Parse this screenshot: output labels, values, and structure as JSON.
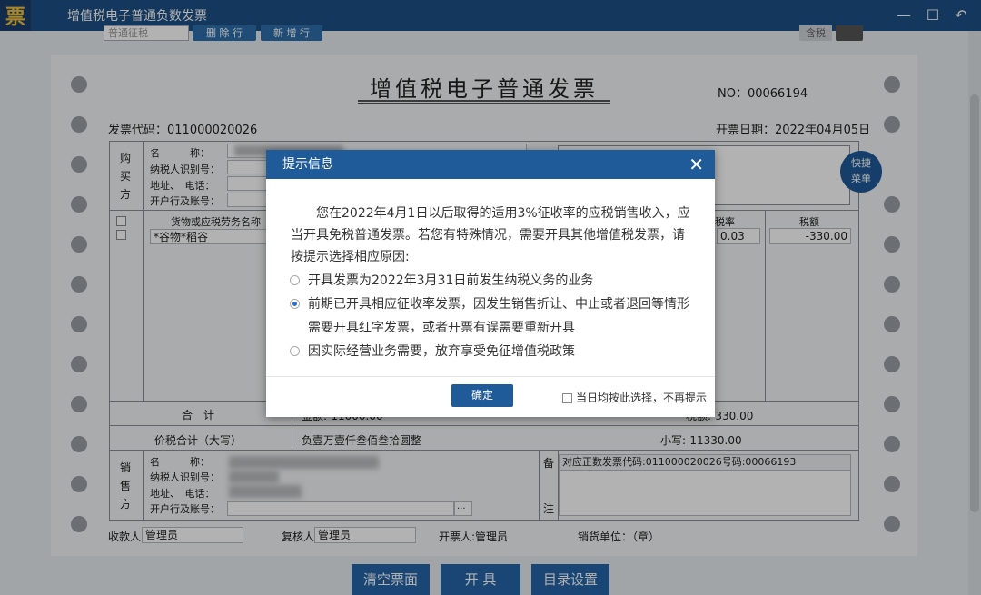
{
  "app": {
    "logo": "票",
    "title": "增值税电子普通负数发票",
    "controls": [
      "—",
      "☐",
      "↶"
    ]
  },
  "toolbar": {
    "select_value": "普通征税",
    "delete_row": "删 除 行",
    "add_row": "新 增 行",
    "tax_label": "含税"
  },
  "invoice": {
    "title": "增值税电子普通发票",
    "no": "NO：00066194",
    "code": "发票代码：011000020026",
    "date": "开票日期：2022年04月05日",
    "buyer": {
      "label": "购买方",
      "name": "名　　　称：",
      "taxid": "纳税人识别号：",
      "addr": "地址、　电话：",
      "bank": "开户行及账号："
    },
    "items_header": {
      "goods": "货物或应税劳务名称",
      "rate": "税率",
      "tax": "税额"
    },
    "item": {
      "name": "*谷物*稻谷",
      "rate": "0.03",
      "tax": "-330.00"
    },
    "total_label": "合　计",
    "total_amount": "金额:-11000.00",
    "total_tax": "税额:-330.00",
    "grand_label": "价税合计（大写）",
    "grand_upper": "负壹万壹仟叁佰叁拾圆整",
    "grand_lower": "小写:-11330.00",
    "seller": {
      "label": "销售方",
      "name": "名　　　称：",
      "taxid": "纳税人识别号：",
      "addr": "地址、　电话：",
      "bank": "开户行及账号："
    },
    "remark_label_top": "备",
    "remark_label_bottom": "注",
    "remark": "对应正数发票代码:011000020026号码:00066193",
    "payee_label": "收款人:",
    "payee": "管理员",
    "reviewer_label": "复核人:",
    "reviewer": "管理员",
    "issuer": "开票人:管理员",
    "seller_unit": "销货单位：（章）",
    "ellipsis": "···"
  },
  "quick_menu": [
    "快捷",
    "菜单"
  ],
  "dialog": {
    "title": "提示信息",
    "close": "✕",
    "message": "您在2022年4月1日以后取得的适用3%征收率的应税销售收入，应当开具免税普通发票。若您有特殊情况，需要开具其他增值税发票，请按提示选择相应原因:",
    "options": [
      "开具发票为2022年3月31日前发生纳税义务的业务",
      "前期已开具相应征收率发票，因发生销售折让、中止或者退回等情形需要开具红字发票，或者开票有误需要重新开具",
      "因实际经营业务需要，放弃享受免征增值税政策"
    ],
    "selected_option": 1,
    "confirm": "确定",
    "remember": "当日均按此选择，不再提示"
  },
  "bottom_buttons": {
    "clear": "清空票面",
    "issue": "开 具",
    "catalog": "目录设置"
  }
}
